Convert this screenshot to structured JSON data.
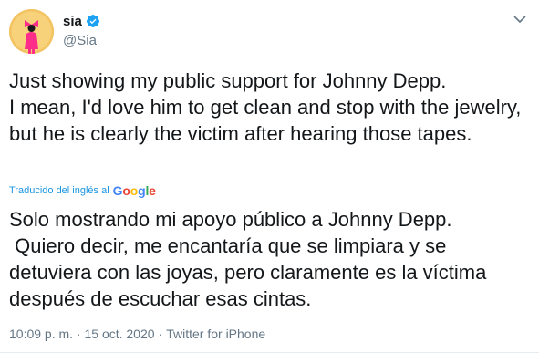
{
  "tweet": {
    "display_name": "sia",
    "handle": "@Sia",
    "text": "Just showing my public support for Johnny Depp.\nI mean, I'd love him to get clean and stop with the jewelry, but he is clearly the victim after hearing those tapes.",
    "translated_from_label": "Traducido del inglés al",
    "translation_provider": "Google",
    "translated_text": "Solo mostrando mi apoyo público a Johnny Depp.\n Quiero decir, me encantaría que se limpiara y se detuviera con las joyas, pero claramente es la víctima después de escuchar esas cintas.",
    "timestamp": "10:09 p. m. · 15 oct. 2020",
    "separator": "·",
    "source": "Twitter for iPhone"
  },
  "icons": {
    "verified": "verified-badge-icon",
    "caret": "chevron-down-icon",
    "avatar": "profile-avatar"
  },
  "colors": {
    "link_blue": "#1b95e0",
    "verified_blue": "#1da1f2",
    "muted_gray": "#657786",
    "text": "#14171a"
  }
}
